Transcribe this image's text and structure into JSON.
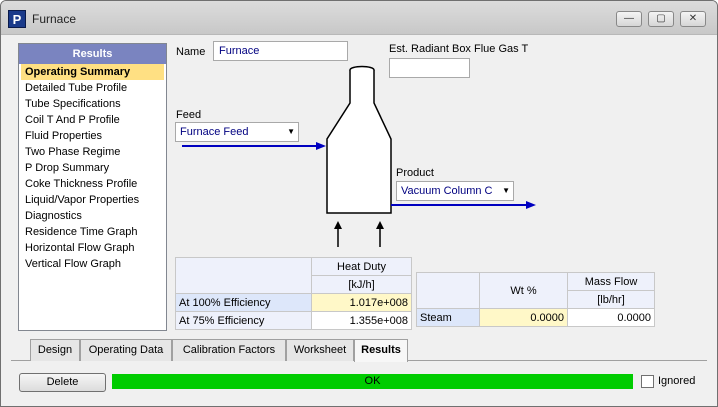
{
  "window": {
    "icon_letter": "P",
    "title": "Furnace",
    "min": "—",
    "max": "▢",
    "close": "✕"
  },
  "nav": {
    "header": "Results",
    "items": [
      "Operating Summary",
      "Detailed Tube Profile",
      "Tube Specifications",
      "Coil T And P Profile",
      "Fluid Properties",
      "Two Phase Regime",
      "P Drop Summary",
      "Coke Thickness Profile",
      "Liquid/Vapor Properties",
      "Diagnostics",
      "Residence Time Graph",
      "Horizontal Flow Graph",
      "Vertical Flow Graph"
    ],
    "selected_index": 0
  },
  "name_label": "Name",
  "name_value": "Furnace",
  "flue_label": "Est. Radiant Box Flue Gas T",
  "flue_value": "",
  "feed_label": "Feed",
  "feed_value": "Furnace Feed",
  "product_label": "Product",
  "product_value": "Vacuum Column C",
  "heat_table": {
    "header1": "Heat Duty",
    "header2": "[kJ/h]",
    "rows": [
      {
        "label": "At 100% Efficiency",
        "value": "1.017e+008"
      },
      {
        "label": "At 75% Efficiency",
        "value": "1.355e+008"
      }
    ]
  },
  "steam_table": {
    "col1": "Wt %",
    "col2a": "Mass Flow",
    "col2b": "[lb/hr]",
    "row_label": "Steam",
    "wt": "0.0000",
    "mass": "0.0000"
  },
  "tabs": [
    "Design",
    "Operating Data",
    "Calibration Factors",
    "Worksheet",
    "Results"
  ],
  "active_tab": "Results",
  "delete_label": "Delete",
  "status_text": "OK",
  "status_color": "#00cc00",
  "ignored_label": "Ignored"
}
